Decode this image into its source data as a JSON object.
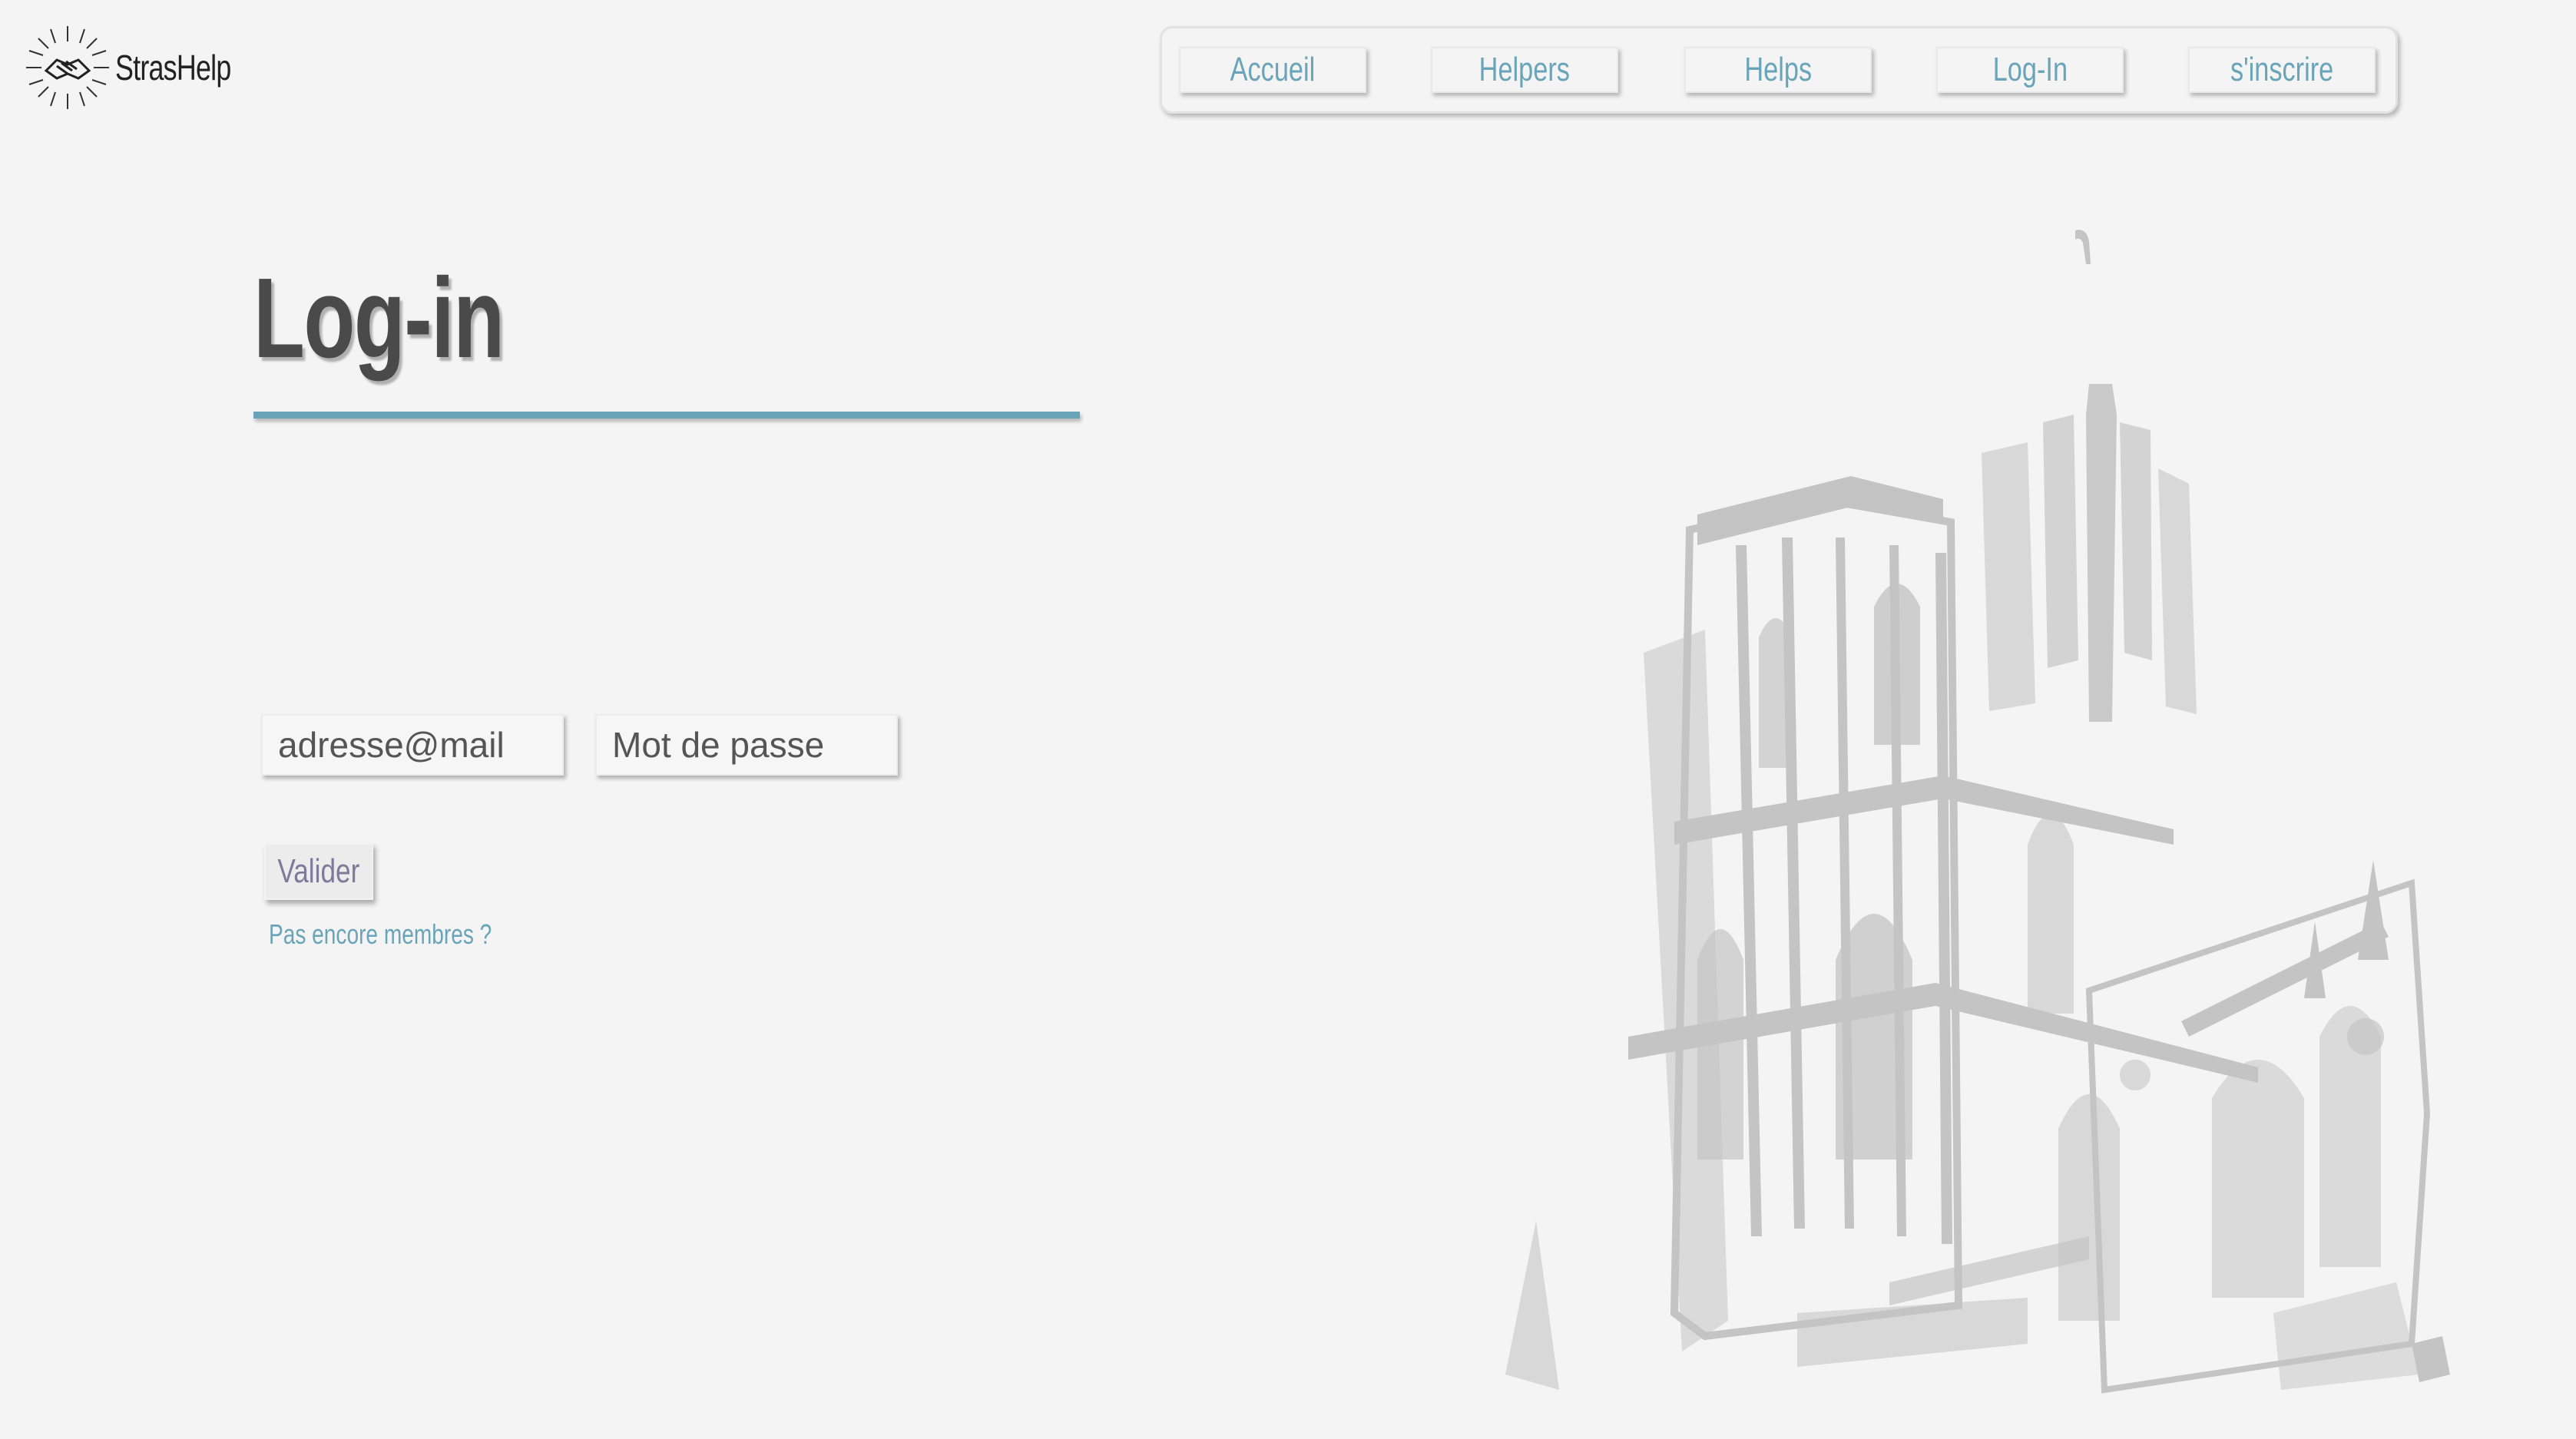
{
  "brand": {
    "name": "StrasHelp",
    "logo_icon": "handshake-sun-icon"
  },
  "nav": {
    "items": [
      {
        "label": "Accueil"
      },
      {
        "label": "Helpers"
      },
      {
        "label": "Helps"
      },
      {
        "label": "Log-In"
      },
      {
        "label": "s'inscrire"
      }
    ],
    "text_color": "#6aa4b8"
  },
  "login": {
    "title": "Log-in",
    "email": {
      "value": "",
      "placeholder": "adresse@mail"
    },
    "password": {
      "value": "",
      "placeholder": "Mot de passe"
    },
    "submit_label": "Valider",
    "signup_link": "Pas encore membres ?"
  },
  "illustration": {
    "icon": "strasbourg-cathedral-icon"
  },
  "colors": {
    "accent": "#6aa4b8",
    "background": "#f4f4f4",
    "title": "#4a4a4a"
  }
}
